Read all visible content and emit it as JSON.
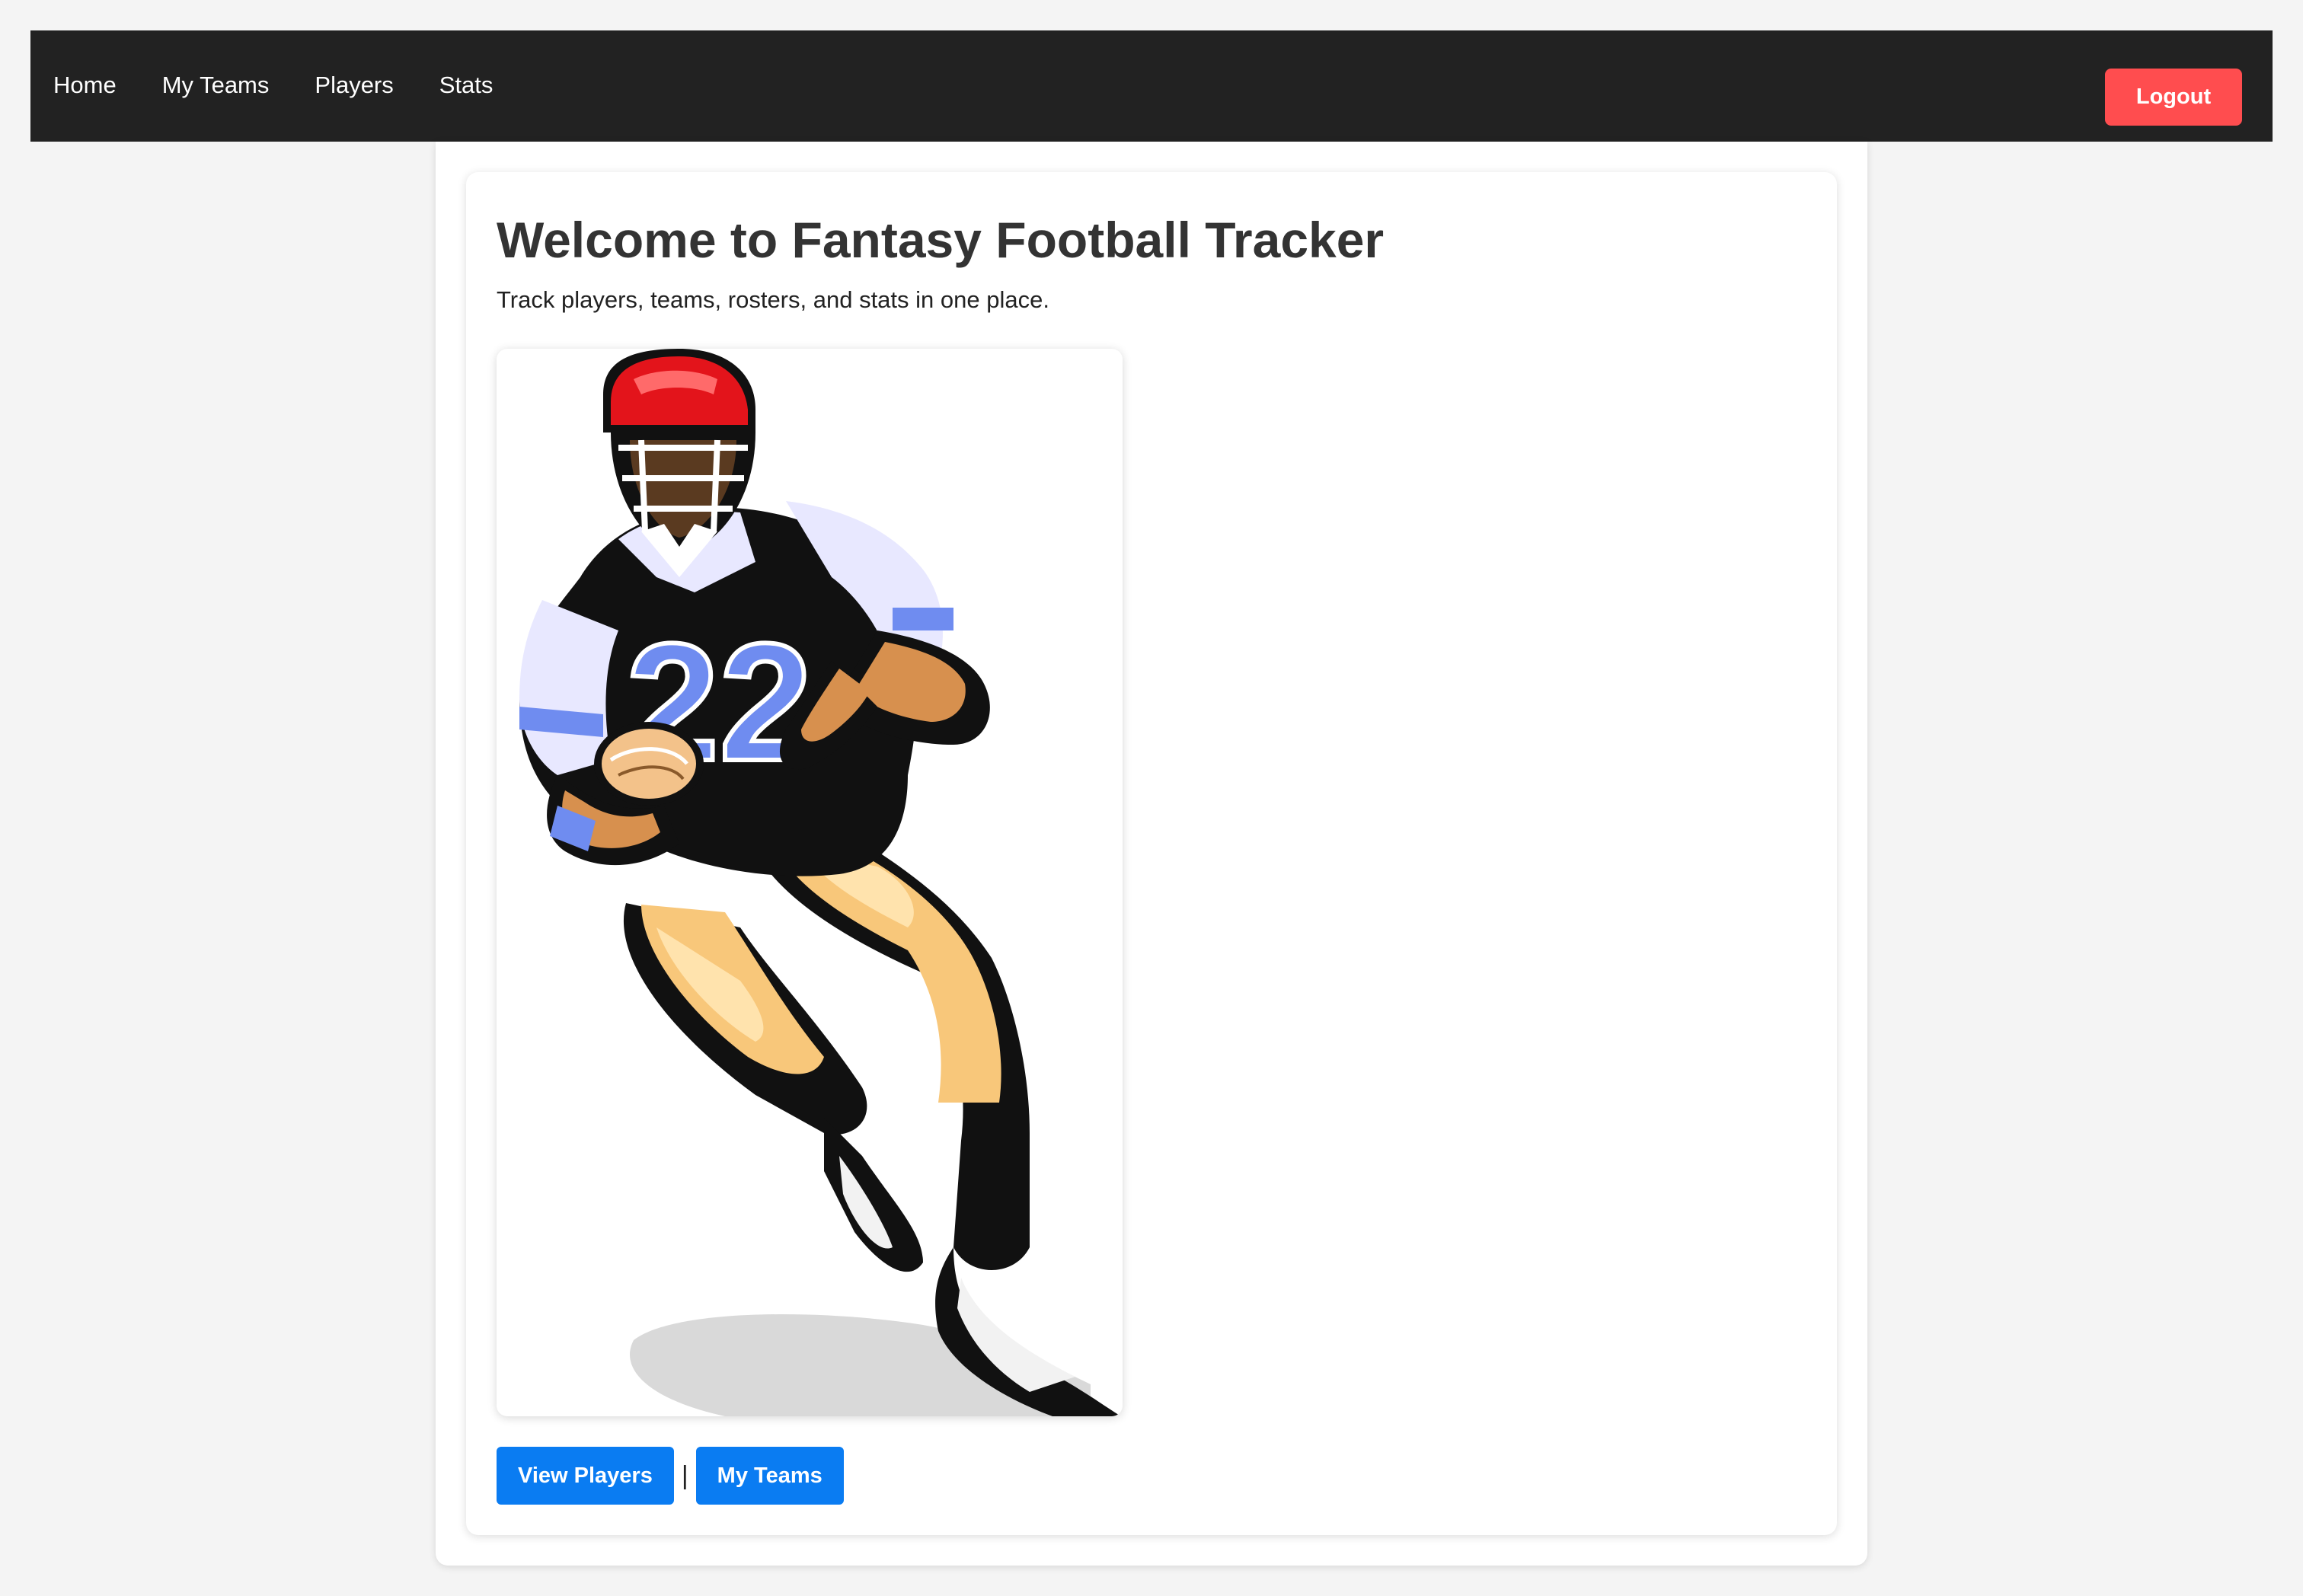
{
  "nav": {
    "links": [
      {
        "label": "Home"
      },
      {
        "label": "My Teams"
      },
      {
        "label": "Players"
      },
      {
        "label": "Stats"
      }
    ],
    "logout_label": "Logout"
  },
  "main": {
    "title": "Welcome to Fantasy Football Tracker",
    "subtitle": "Track players, teams, rosters, and stats in one place.",
    "hero_image": "football-player-illustration",
    "jersey_number": "22",
    "actions": {
      "view_players_label": "View Players",
      "separator": "|",
      "my_teams_label": "My Teams"
    }
  },
  "colors": {
    "navbar_bg": "#222222",
    "logout_bg": "#ff4d4f",
    "primary_button": "#0a7cf2",
    "page_bg": "#f4f4f4",
    "helmet": "#e3141b",
    "jersey_accent": "#6f8cf0",
    "pants": "#f7c46f"
  }
}
